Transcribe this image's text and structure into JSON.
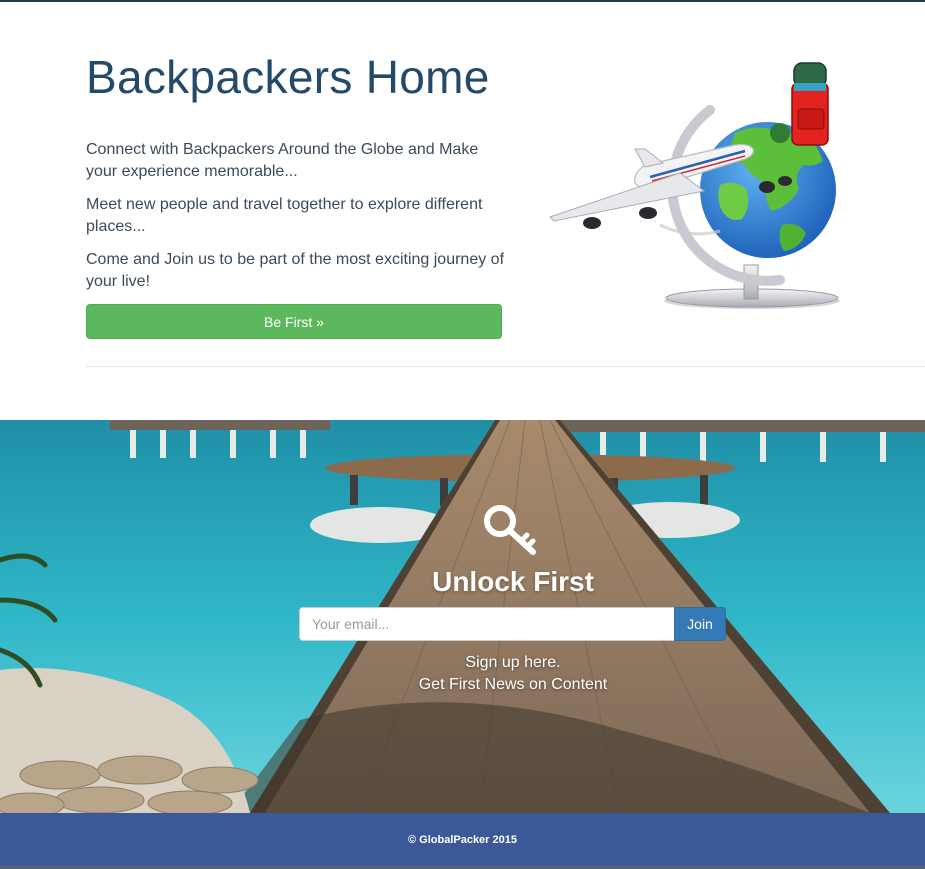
{
  "hero": {
    "title": "Backpackers Home",
    "paragraphs": [
      "Connect with Backpackers Around the Globe and Make your experience memorable...",
      "Meet new people and travel together to explore different places...",
      "Come and Join us to be part of the most exciting journey of your live!"
    ],
    "cta_label": "Be First »"
  },
  "signup": {
    "icon": "key-icon",
    "title": "Unlock First",
    "email_placeholder": "Your email...",
    "join_label": "Join",
    "line1": "Sign up here.",
    "line2": "Get First News on Content"
  },
  "footer": {
    "copyright": "© GlobalPacker 2015"
  },
  "colors": {
    "title": "#234a6b",
    "cta": "#5cb85c",
    "join": "#337ab7",
    "footer": "#3b5998"
  }
}
